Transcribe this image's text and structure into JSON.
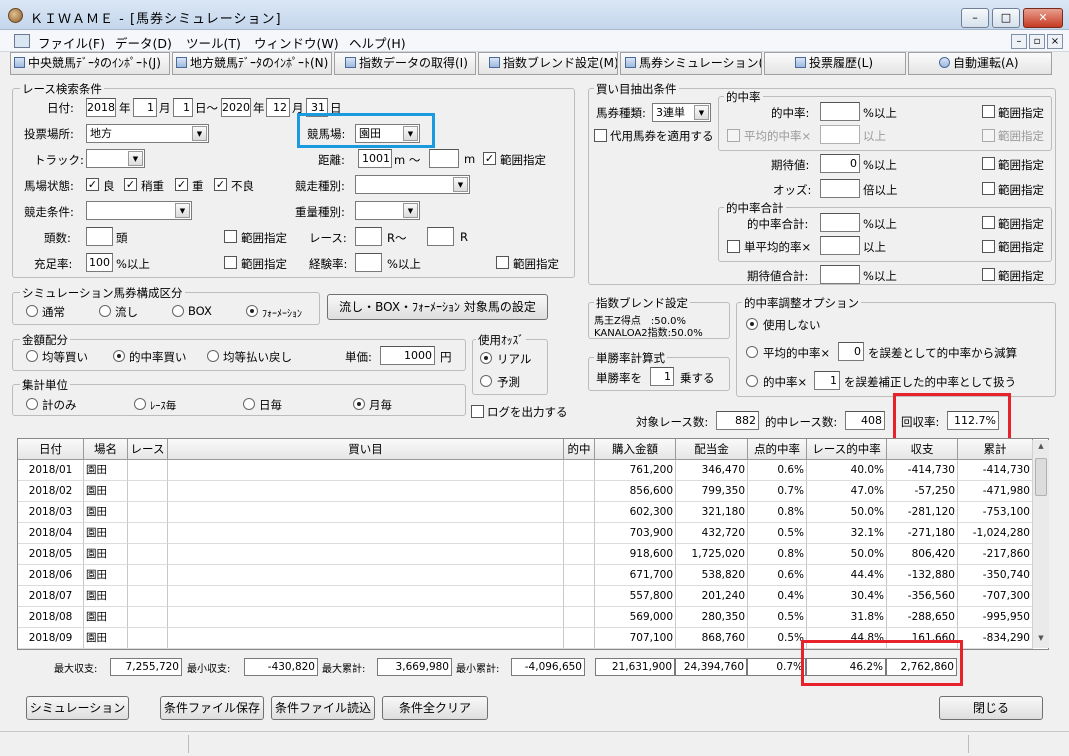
{
  "window": {
    "title": "ＫＩＷＡＭＥ - [馬券シミュレーション]",
    "minimize": "–",
    "maximize": "□",
    "close": "✕"
  },
  "menu": [
    "ファイル(F)",
    "データ(D)",
    "ツール(T)",
    "ウィンドウ(W)",
    "ヘルプ(H)"
  ],
  "mdi_buttons": [
    "–",
    "▫",
    "×"
  ],
  "toolbar": [
    "中央競馬ﾃﾞｰﾀのｲﾝﾎﾟｰﾄ(J)",
    "地方競馬ﾃﾞｰﾀのｲﾝﾎﾟｰﾄ(N)",
    "指数データの取得(I)",
    "指数ブレンド設定(M)",
    "馬券シミュレーション(B)",
    "投票履歴(L)",
    "自動運転(A)"
  ],
  "race": {
    "group": "レース検索条件",
    "date_label": "日付:",
    "from_year": "2018",
    "from_month": "1",
    "from_day": "1",
    "to_year": "2020",
    "to_month": "12",
    "to_day": "31",
    "year_unit": "年",
    "month_unit": "月",
    "day_unit": "日",
    "tilde": "日〜",
    "venue_label": "投票場所:",
    "venue_value": "地方",
    "course_label": "競馬場:",
    "course_value": "園田",
    "track_label": "トラック:",
    "track_value": "",
    "distance_label": "距離:",
    "distance_value": "1001",
    "distance_unit1": "m 〜",
    "distance_to": "",
    "distance_unit2": "m",
    "range_label": "範囲指定",
    "cond_label": "馬場状態:",
    "cond_items": [
      "良",
      "稍重",
      "重",
      "不良"
    ],
    "kind_label": "競走種別:",
    "kind_value": "",
    "race_cond_label": "競走条件:",
    "race_cond_value": "",
    "weight_label": "重量種別:",
    "weight_value": "",
    "heads_label": "頭数:",
    "heads_value": "",
    "heads_unit": "頭",
    "race_label": "レース:",
    "race_from": "",
    "race_mid": "R〜",
    "race_to": "",
    "race_unit": "R",
    "fill_label": "充足率:",
    "fill_value": "100",
    "fill_unit": "%以上",
    "exp_label": "経験率:",
    "exp_value": "",
    "exp_unit": "%以上"
  },
  "sim": {
    "group": "シミュレーション馬券構成区分",
    "options": [
      "通常",
      "流し",
      "BOX",
      "ﾌｫｰﾒｰｼｮﾝ"
    ],
    "button": "流し・BOX・ﾌｫｰﾒｰｼｮﾝ 対象馬の設定"
  },
  "money": {
    "group": "金額配分",
    "options": [
      "均等買い",
      "的中率買い",
      "均等払い戻し"
    ],
    "unit_label": "単価:",
    "unit_value": "1000",
    "unit": "円"
  },
  "odds": {
    "group": "使用ｵｯｽﾞ",
    "options": [
      "リアル",
      "予測"
    ]
  },
  "agg": {
    "group": "集計単位",
    "options": [
      "計のみ",
      "ﾚｰｽ毎",
      "日毎",
      "月毎"
    ]
  },
  "log_label": "ログを出力する",
  "buy": {
    "group": "買い目抽出条件",
    "type_label": "馬券種類:",
    "type_value": "3連単",
    "substitute": "代用馬券を適用する",
    "hit_group": "的中率",
    "hit_label": "的中率:",
    "hit_value": "",
    "hit_unit": "%以上",
    "avg_label": "平均的中率×",
    "avg_value": "",
    "avg_unit": "以上",
    "exp_label": "期待値:",
    "exp_value": "0",
    "exp_unit": "%以上",
    "odds_label": "オッズ:",
    "odds_value": "",
    "odds_unit": "倍以上",
    "sum_group": "的中率合計",
    "sum_label": "的中率合計:",
    "sum_value": "",
    "sum_unit": "%以上",
    "single_label": "単平均的率×",
    "single_value": "",
    "single_unit": "以上",
    "expsum_label": "期待値合計:",
    "expsum_value": "",
    "expsum_unit": "%以上",
    "range_label": "範囲指定"
  },
  "blend": {
    "group": "指数ブレンド設定",
    "line1": "馬王Z得点　:50.0%",
    "line2": "KANALOA2指数:50.0%"
  },
  "win": {
    "group": "単勝率計算式",
    "label": "単勝率を",
    "value": "1",
    "unit": "乗する"
  },
  "adjust": {
    "group": "的中率調整オプション",
    "opt1": "使用しない",
    "opt2_a": "平均的中率×",
    "opt2_value": "0",
    "opt2_b": "を誤差として的中率から減算",
    "opt3_a": "的中率×",
    "opt3_value": "1",
    "opt3_b": "を誤差補正した的中率として扱う"
  },
  "stats": {
    "target_label": "対象レース数:",
    "target": "882",
    "hit_label": "的中レース数:",
    "hit": "408",
    "rate_label": "回収率:",
    "rate": "112.7%"
  },
  "table": {
    "headers": [
      "日付",
      "場名",
      "レース",
      "買い目",
      "的中",
      "購入金額",
      "配当金",
      "点的中率",
      "レース的中率",
      "収支",
      "累計"
    ],
    "rows": [
      [
        "2018/01",
        "園田",
        "",
        "",
        "",
        "761,200",
        "346,470",
        "0.6%",
        "40.0%",
        "-414,730",
        "-414,730"
      ],
      [
        "2018/02",
        "園田",
        "",
        "",
        "",
        "856,600",
        "799,350",
        "0.7%",
        "47.0%",
        "-57,250",
        "-471,980"
      ],
      [
        "2018/03",
        "園田",
        "",
        "",
        "",
        "602,300",
        "321,180",
        "0.8%",
        "50.0%",
        "-281,120",
        "-753,100"
      ],
      [
        "2018/04",
        "園田",
        "",
        "",
        "",
        "703,900",
        "432,720",
        "0.5%",
        "32.1%",
        "-271,180",
        "-1,024,280"
      ],
      [
        "2018/05",
        "園田",
        "",
        "",
        "",
        "918,600",
        "1,725,020",
        "0.8%",
        "50.0%",
        "806,420",
        "-217,860"
      ],
      [
        "2018/06",
        "園田",
        "",
        "",
        "",
        "671,700",
        "538,820",
        "0.6%",
        "44.4%",
        "-132,880",
        "-350,740"
      ],
      [
        "2018/07",
        "園田",
        "",
        "",
        "",
        "557,800",
        "201,240",
        "0.4%",
        "30.4%",
        "-356,560",
        "-707,300"
      ],
      [
        "2018/08",
        "園田",
        "",
        "",
        "",
        "569,000",
        "280,350",
        "0.5%",
        "31.8%",
        "-288,650",
        "-995,950"
      ],
      [
        "2018/09",
        "園田",
        "",
        "",
        "",
        "707,100",
        "868,760",
        "0.5%",
        "44.8%",
        "161,660",
        "-834,290"
      ]
    ]
  },
  "summary": {
    "max_label": "最大収支:",
    "max": "7,255,720",
    "min_label": "最小収支:",
    "min": "-430,820",
    "maxcum_label": "最大累計:",
    "maxcum": "3,669,980",
    "mincum_label": "最小累計:",
    "mincum": "-4,096,650",
    "buy": "21,631,900",
    "pay": "24,394,760",
    "pt": "0.7%",
    "race": "46.2%",
    "total": "2,762,860"
  },
  "bottom": {
    "simulate": "シミュレーション",
    "save": "条件ファイル保存",
    "load": "条件ファイル読込",
    "clear": "条件全クリア",
    "close": "閉じる"
  },
  "colors": {
    "highlight_red": "#e8222a",
    "highlight_blue": "#1a9ae0"
  }
}
